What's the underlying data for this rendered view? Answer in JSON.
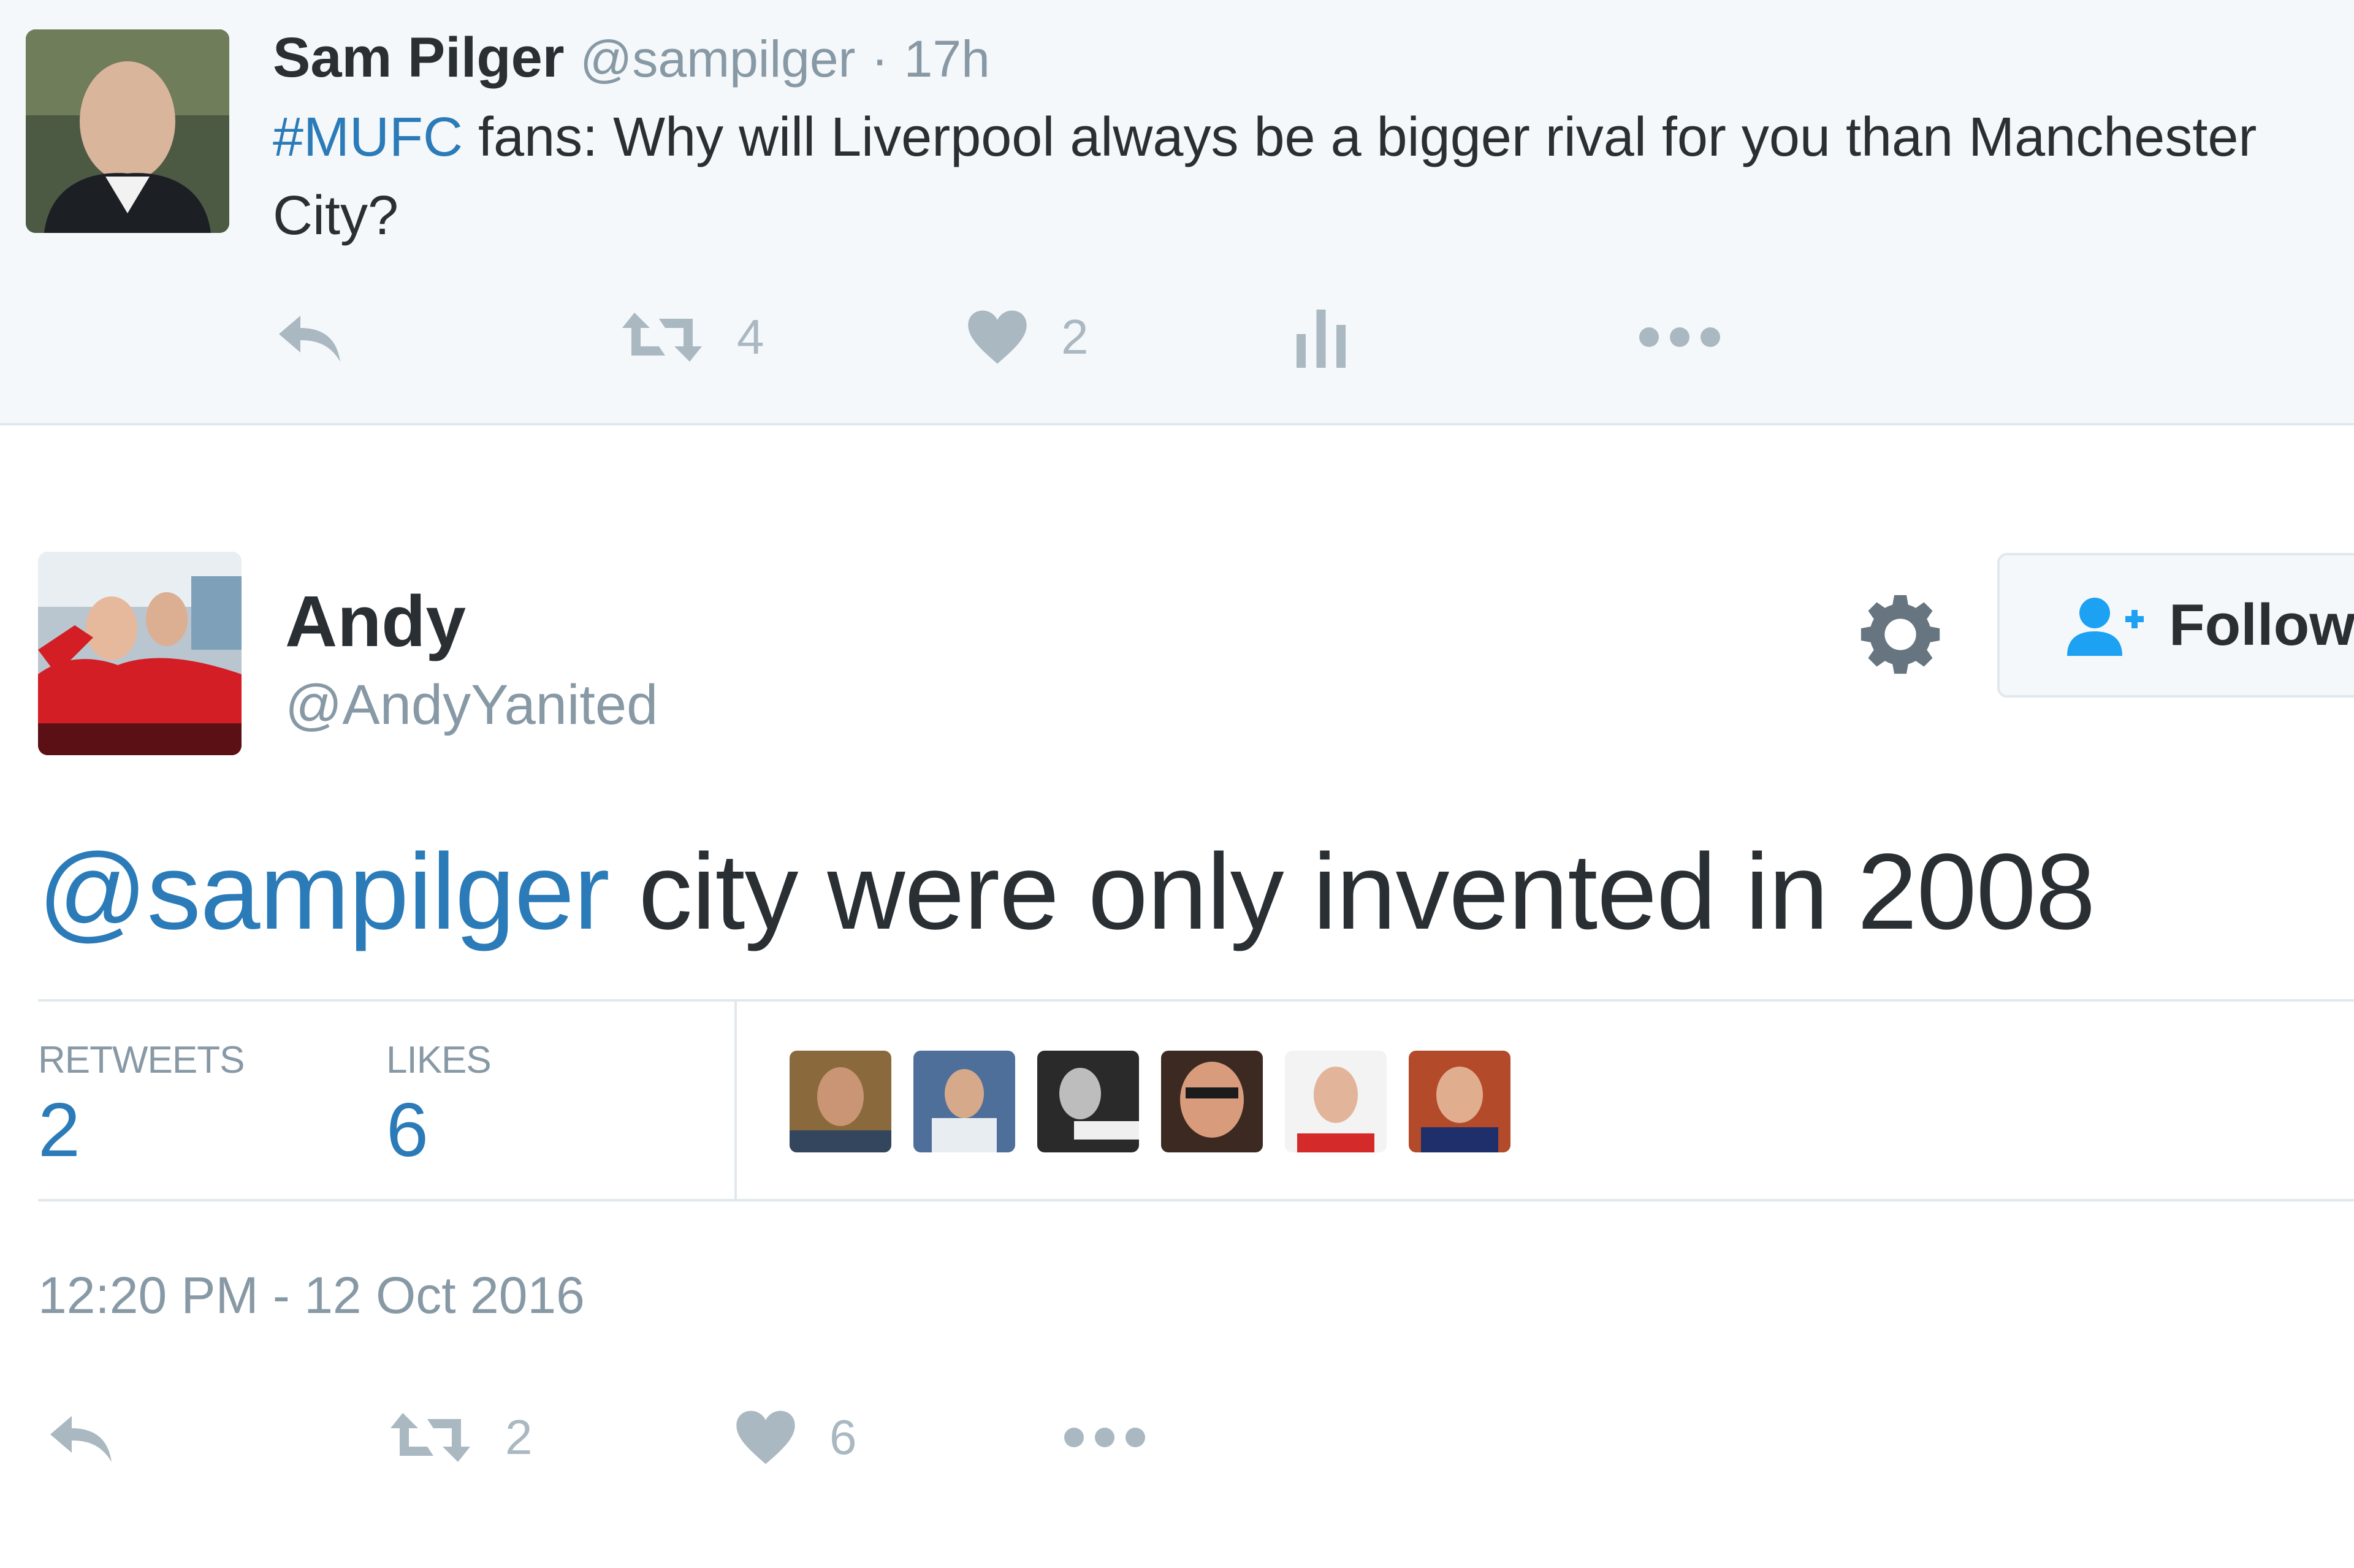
{
  "parent_tweet": {
    "name": "Sam Pilger",
    "handle": "@sampilger",
    "separator": "·",
    "time": "17h",
    "text_hashtag": "#MUFC",
    "text_line1_rest": " fans: Why will Liverpool always be a bigger rival for you than Manchester",
    "text_line2": "City?",
    "retweets": "4",
    "likes": "2",
    "icons": [
      "reply-icon",
      "retweet-icon",
      "heart-icon",
      "analytics-icon",
      "more-icon"
    ]
  },
  "main_tweet": {
    "name": "Andy",
    "handle": "@AndyYanited",
    "follow_label": "Follow",
    "mention": "@sampilger",
    "text_rest": " city were only invented in 2008",
    "stats": {
      "retweets_label": "RETWEETS",
      "retweets_value": "2",
      "likes_label": "LIKES",
      "likes_value": "6"
    },
    "likers_count": 6,
    "timestamp": "12:20 PM - 12 Oct 2016",
    "actions": {
      "retweets": "2",
      "likes": "6"
    },
    "icons": [
      "gear-icon",
      "follow-person-icon",
      "reply-icon",
      "retweet-icon",
      "heart-icon",
      "more-icon"
    ]
  },
  "colors": {
    "link": "#2b7bb9",
    "muted": "#8899a6",
    "icon": "#aab8c2",
    "text": "#292f33",
    "border": "#e1e8ed",
    "parent_bg": "#f5f8fa"
  }
}
